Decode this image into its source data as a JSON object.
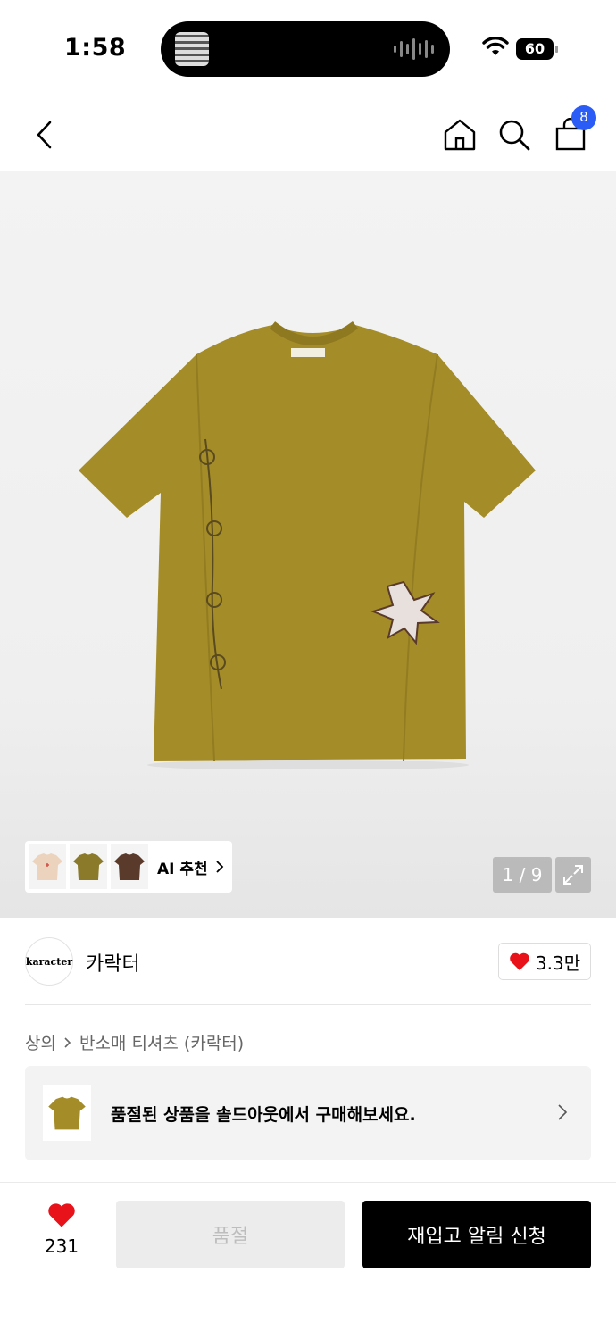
{
  "status": {
    "time": "1:58",
    "battery": "60"
  },
  "nav": {
    "cart_count": "8"
  },
  "gallery": {
    "ai_label": "AI 추천",
    "counter": "1 / 9",
    "ai_thumbs": [
      "#ecd3bd",
      "#8a7a2a",
      "#5a3a2a"
    ]
  },
  "brand": {
    "logo_text": "karacter",
    "name": "카락터",
    "likes": "3.3만"
  },
  "breadcrumb": {
    "category": "상의",
    "subcategory": "반소매 티셔츠 (카락터)"
  },
  "banner": {
    "text": "품절된 상품을 솔드아웃에서 구매해보세요."
  },
  "bottom": {
    "wish_count": "231",
    "soldout_label": "품절",
    "restock_label": "재입고 알림 신청"
  },
  "colors": {
    "accent": "#2b5cf5",
    "heart": "#e8121b",
    "shirt": "#a48c28"
  }
}
